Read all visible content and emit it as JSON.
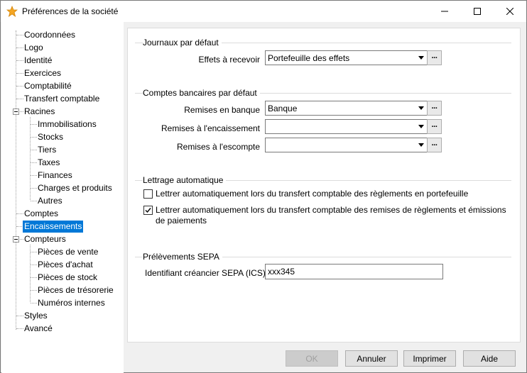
{
  "window": {
    "title": "Préférences de la société",
    "icon": "star-icon"
  },
  "tree": {
    "items": [
      {
        "label": "Coordonnées",
        "level": 0
      },
      {
        "label": "Logo",
        "level": 0
      },
      {
        "label": "Identité",
        "level": 0
      },
      {
        "label": "Exercices",
        "level": 0
      },
      {
        "label": "Comptabilité",
        "level": 0
      },
      {
        "label": "Transfert comptable",
        "level": 0
      },
      {
        "label": "Racines",
        "level": 0,
        "expanded": true
      },
      {
        "label": "Immobilisations",
        "level": 1
      },
      {
        "label": "Stocks",
        "level": 1
      },
      {
        "label": "Tiers",
        "level": 1
      },
      {
        "label": "Taxes",
        "level": 1
      },
      {
        "label": "Finances",
        "level": 1
      },
      {
        "label": "Charges et produits",
        "level": 1
      },
      {
        "label": "Autres",
        "level": 1
      },
      {
        "label": "Comptes",
        "level": 0
      },
      {
        "label": "Encaissements",
        "level": 0,
        "selected": true
      },
      {
        "label": "Compteurs",
        "level": 0,
        "expanded": true
      },
      {
        "label": "Pièces de vente",
        "level": 1
      },
      {
        "label": "Pièces d'achat",
        "level": 1
      },
      {
        "label": "Pièces de stock",
        "level": 1
      },
      {
        "label": "Pièces de trésorerie",
        "level": 1
      },
      {
        "label": "Numéros internes",
        "level": 1
      },
      {
        "label": "Styles",
        "level": 0
      },
      {
        "label": "Avancé",
        "level": 0
      }
    ]
  },
  "journaux": {
    "title": "Journaux par défaut",
    "effets_label": "Effets à recevoir",
    "effets_value": "Portefeuille des effets"
  },
  "comptes": {
    "title": "Comptes bancaires par défaut",
    "remises_banque_label": "Remises en banque",
    "remises_banque_value": "Banque",
    "remises_encaissement_label": "Remises à l'encaissement",
    "remises_encaissement_value": "",
    "remises_escompte_label": "Remises à l'escompte",
    "remises_escompte_value": ""
  },
  "lettrage": {
    "title": "Lettrage automatique",
    "check1_label": "Lettrer automatiquement lors du transfert comptable des règlements en portefeuille",
    "check1_checked": false,
    "check2_label_line1": "Lettrer automatiquement lors du transfert comptable des remises de règlements et émissions",
    "check2_label_line2": "de paiements",
    "check2_checked": true
  },
  "sepa": {
    "title": "Prélèvements SEPA",
    "ics_label": "Identifiant créancier SEPA (ICS)",
    "ics_value": "xxx345"
  },
  "buttons": {
    "ok": "OK",
    "annuler": "Annuler",
    "imprimer": "Imprimer",
    "aide": "Aide"
  },
  "colors": {
    "selection": "#0078d7",
    "star": "#f5a623"
  }
}
